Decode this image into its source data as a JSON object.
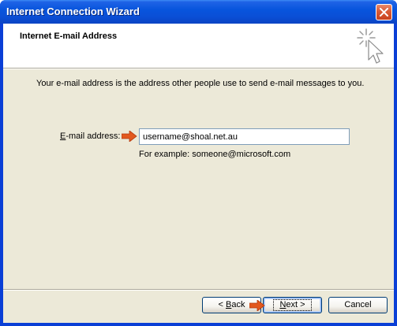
{
  "window": {
    "title": "Internet Connection Wizard",
    "close_icon": "close-icon"
  },
  "header": {
    "title": "Internet E-mail Address",
    "icon": "wizard-sparkle-cursor-icon"
  },
  "main": {
    "intro_text": "Your e-mail address is the address other people use to send e-mail messages to you.",
    "email_label_accel": "E",
    "email_label_rest": "-mail address:",
    "email_value": "username@shoal.net.au",
    "hint": "For example: someone@microsoft.com",
    "arrow_icon": "red-arrow-icon"
  },
  "buttons": {
    "back_prefix": "< ",
    "back_accel": "B",
    "back_rest": "ack",
    "next_accel": "N",
    "next_rest": "ext >",
    "cancel": "Cancel"
  },
  "colors": {
    "titlebar": "#0a4fd6",
    "dialog_bg": "#ece9d8",
    "arrow": "#e2581e",
    "close_button": "#d95a35"
  }
}
